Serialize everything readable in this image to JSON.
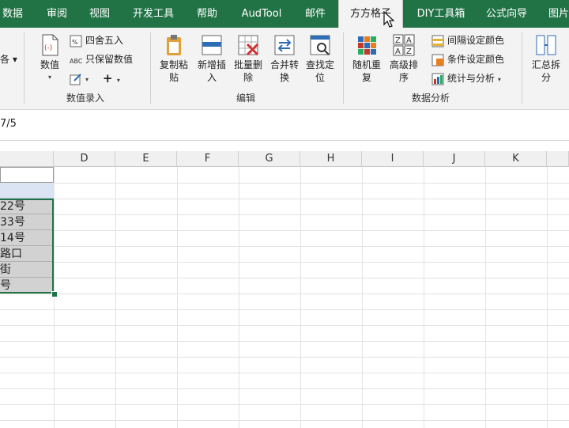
{
  "tabs": [
    {
      "label": "数据",
      "active": false
    },
    {
      "label": "审阅",
      "active": false
    },
    {
      "label": "视图",
      "active": false
    },
    {
      "label": "开发工具",
      "active": false
    },
    {
      "label": "帮助",
      "active": false
    },
    {
      "label": "AudTool",
      "active": false
    },
    {
      "label": "邮件",
      "active": false
    },
    {
      "label": "方方格子",
      "active": true
    },
    {
      "label": "DIY工具箱",
      "active": false
    },
    {
      "label": "公式向导",
      "active": false
    },
    {
      "label": "图片",
      "active": false
    }
  ],
  "ribbon": {
    "partial_left": "各 ▾",
    "numeric": {
      "value_button": "数值",
      "round_button": "四舍五入",
      "keep_value_button": "只保留数值",
      "plus_label": "+",
      "group_label": "数值录入"
    },
    "edit": {
      "copy_paste": "复制粘贴",
      "add_insert": "新增插入",
      "batch_delete": "批量删除",
      "merge_convert": "合并转换",
      "find_locate": "查找定位",
      "group_label": "编辑"
    },
    "analysis": {
      "random_repeat": "随机重复",
      "advanced_sort": "高级排序",
      "interval_color": "间隔设定颜色",
      "condition_color": "条件设定颜色",
      "stats_analysis": "统计与分析",
      "group_label": "数据分析"
    },
    "summary": {
      "summary_split": "汇总拆分"
    }
  },
  "formula_bar": {
    "text": "7/5"
  },
  "columns": [
    "D",
    "E",
    "F",
    "G",
    "H",
    "I",
    "J",
    "K"
  ],
  "cells": [
    "",
    "",
    "22号",
    "33号",
    "14号",
    "路口",
    "街",
    "号"
  ]
}
